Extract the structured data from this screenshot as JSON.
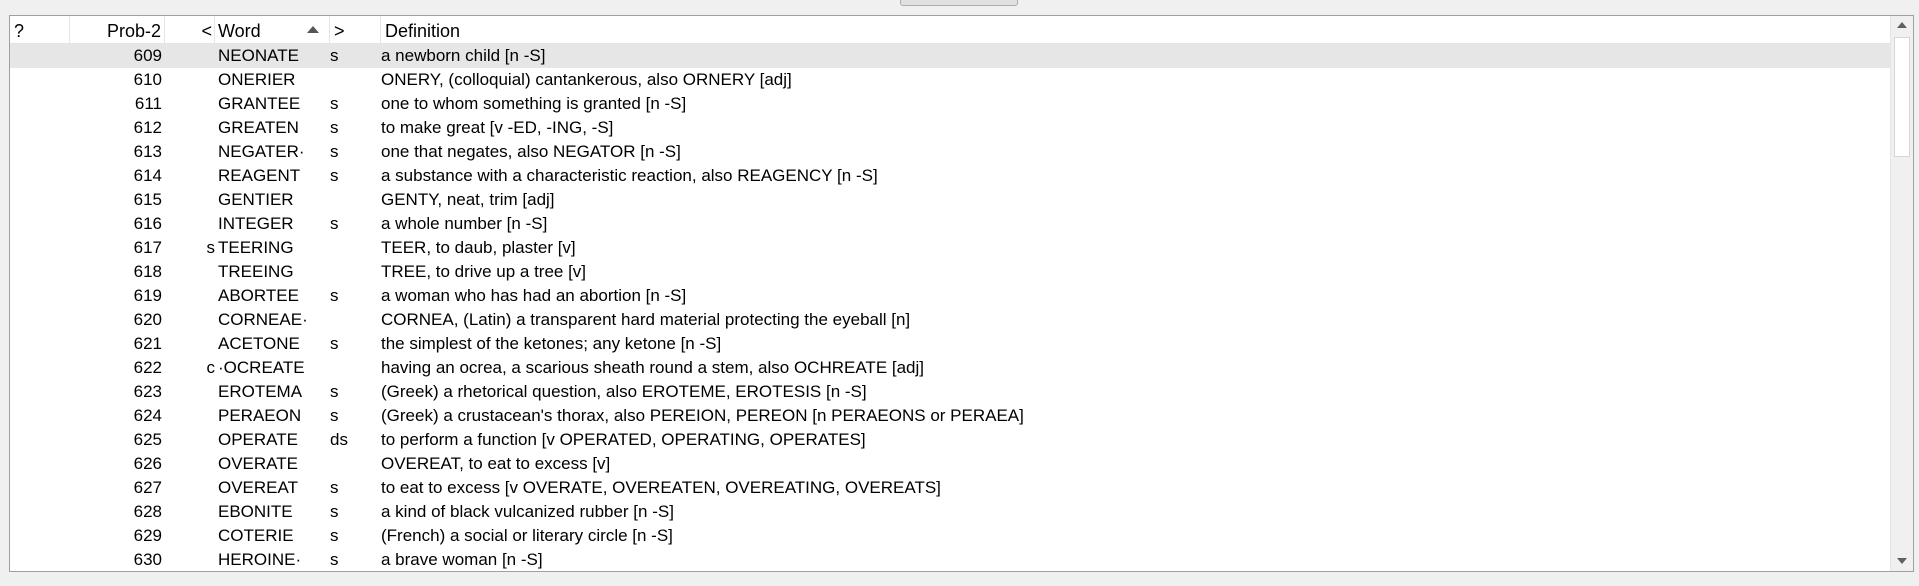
{
  "table": {
    "columns": {
      "probe": "?",
      "prob2": "Prob-2",
      "left_hooks": "<",
      "word": "Word",
      "right_hooks": ">",
      "definition": "Definition"
    },
    "sorted_column": "Word",
    "sort_direction": "ascending",
    "selected_row_index": 0,
    "rows": [
      {
        "prob": "609",
        "lh": "",
        "word": "NEONATE",
        "rh": "s",
        "def": "a newborn child [n -S]"
      },
      {
        "prob": "610",
        "lh": "",
        "word": "ONERIER",
        "rh": "",
        "def": "ONERY, (colloquial) cantankerous, also ORNERY [adj]"
      },
      {
        "prob": "611",
        "lh": "",
        "word": "GRANTEE",
        "rh": "s",
        "def": "one to whom something is granted [n -S]"
      },
      {
        "prob": "612",
        "lh": "",
        "word": "GREATEN",
        "rh": "s",
        "def": "to make great [v -ED, -ING, -S]"
      },
      {
        "prob": "613",
        "lh": "",
        "word": "NEGATER·",
        "rh": "s",
        "def": "one that negates, also NEGATOR [n -S]"
      },
      {
        "prob": "614",
        "lh": "",
        "word": "REAGENT",
        "rh": "s",
        "def": "a substance with a characteristic reaction, also REAGENCY [n -S]"
      },
      {
        "prob": "615",
        "lh": "",
        "word": "GENTIER",
        "rh": "",
        "def": "GENTY, neat, trim [adj]"
      },
      {
        "prob": "616",
        "lh": "",
        "word": "INTEGER",
        "rh": "s",
        "def": "a whole number [n -S]"
      },
      {
        "prob": "617",
        "lh": "s",
        "word": "TEERING",
        "rh": "",
        "def": "TEER, to daub, plaster [v]"
      },
      {
        "prob": "618",
        "lh": "",
        "word": "TREEING",
        "rh": "",
        "def": "TREE, to drive up a tree [v]"
      },
      {
        "prob": "619",
        "lh": "",
        "word": "ABORTEE",
        "rh": "s",
        "def": "a woman who has had an abortion [n -S]"
      },
      {
        "prob": "620",
        "lh": "",
        "word": "CORNEAE·",
        "rh": "",
        "def": "CORNEA, (Latin) a transparent hard material protecting the eyeball [n]"
      },
      {
        "prob": "621",
        "lh": "",
        "word": "ACETONE",
        "rh": "s",
        "def": "the simplest of the ketones; any ketone [n -S]"
      },
      {
        "prob": "622",
        "lh": "c",
        "word": "·OCREATE",
        "rh": "",
        "def": "having an ocrea, a scarious sheath round a stem, also OCHREATE [adj]"
      },
      {
        "prob": "623",
        "lh": "",
        "word": "EROTEMA",
        "rh": "s",
        "def": "(Greek) a rhetorical question, also EROTEME, EROTESIS [n -S]"
      },
      {
        "prob": "624",
        "lh": "",
        "word": "PERAEON",
        "rh": "s",
        "def": "(Greek) a crustacean's thorax, also PEREION, PEREON [n PERAEONS or PERAEA]"
      },
      {
        "prob": "625",
        "lh": "",
        "word": "OPERATE",
        "rh": "ds",
        "def": "to perform a function [v OPERATED, OPERATING, OPERATES]"
      },
      {
        "prob": "626",
        "lh": "",
        "word": "OVERATE",
        "rh": "",
        "def": "OVEREAT, to eat to excess [v]"
      },
      {
        "prob": "627",
        "lh": "",
        "word": "OVEREAT",
        "rh": "s",
        "def": "to eat to excess [v OVERATE, OVEREATEN, OVEREATING, OVEREATS]"
      },
      {
        "prob": "628",
        "lh": "",
        "word": "EBONITE",
        "rh": "s",
        "def": "a kind of black vulcanized rubber [n -S]"
      },
      {
        "prob": "629",
        "lh": "",
        "word": "COTERIE",
        "rh": "s",
        "def": "(French) a social or literary circle [n -S]"
      },
      {
        "prob": "630",
        "lh": "",
        "word": "HEROINE·",
        "rh": "s",
        "def": "a brave woman [n -S]"
      }
    ]
  },
  "colors": {
    "selected_row": "#e6e6e6",
    "grid_line": "#e5e5e5",
    "frame_border": "#a0a0a0"
  }
}
